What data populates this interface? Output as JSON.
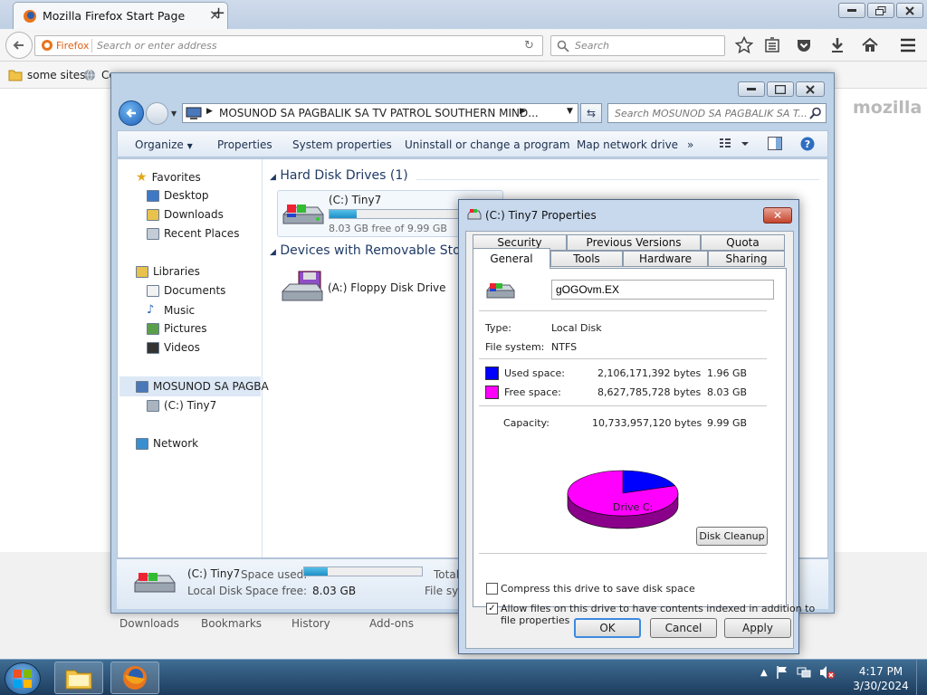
{
  "firefox": {
    "tab_title": "Mozilla Firefox Start Page",
    "new_tab": "+",
    "url_brand": "Firefox",
    "url_placeholder": "Search or enter address",
    "search_placeholder": "Search",
    "bookmarks": [
      "some sites",
      "Co"
    ],
    "brand_mark": "mozilla",
    "bottom_links": [
      "Downloads",
      "Bookmarks",
      "History",
      "Add-ons"
    ]
  },
  "explorer": {
    "address": "MOSUNOD SA PAGBALIK SA TV PATROL SOUTHERN MIND...",
    "search_placeholder": "Search MOSUNOD SA PAGBALIK SA T...",
    "toolbar": [
      "Organize",
      "Properties",
      "System properties",
      "Uninstall or change a program",
      "Map network drive",
      "»"
    ],
    "nav": {
      "favorites": "Favorites",
      "desktop": "Desktop",
      "downloads": "Downloads",
      "recent": "Recent Places",
      "libraries": "Libraries",
      "documents": "Documents",
      "music": "Music",
      "pictures": "Pictures",
      "videos": "Videos",
      "computer": "MOSUNOD SA PAGBA",
      "drive_c": "(C:) Tiny7",
      "network": "Network"
    },
    "groups": {
      "hdd": "Hard Disk Drives (1)",
      "removable": "Devices with Removable Stora"
    },
    "drive_c": {
      "name": "(C:) Tiny7",
      "free_text": "8.03 GB free of 9.99 GB",
      "used_fraction": 0.2
    },
    "drive_a": {
      "name": "(A:) Floppy Disk Drive"
    },
    "details": {
      "name": "(C:) Tiny7",
      "type": "Local Disk",
      "space_used_label": "Space used:",
      "space_free_label": "Space free:",
      "space_free": "8.03 GB",
      "total": "Total",
      "filesys": "File sys",
      "used_fraction": 0.2
    }
  },
  "dialog": {
    "title": "(C:) Tiny7 Properties",
    "tabs_back": [
      "Security",
      "Previous Versions",
      "Quota"
    ],
    "tabs_front": [
      "General",
      "Tools",
      "Hardware",
      "Sharing"
    ],
    "volume_label": "gOGOvm.EX",
    "type_label": "Type:",
    "type_value": "Local Disk",
    "fs_label": "File system:",
    "fs_value": "NTFS",
    "used_label": "Used space:",
    "used_bytes": "2,106,171,392 bytes",
    "used_gb": "1.96 GB",
    "free_label": "Free space:",
    "free_bytes": "8,627,785,728 bytes",
    "free_gb": "8.03 GB",
    "cap_label": "Capacity:",
    "cap_bytes": "10,733,957,120 bytes",
    "cap_gb": "9.99 GB",
    "drive_caption": "Drive C:",
    "cleanup": "Disk Cleanup",
    "compress": "Compress this drive to save disk space",
    "index_line1": "Allow files on this drive to have contents indexed in addition to",
    "index_line2": "file properties",
    "ok": "OK",
    "cancel": "Cancel",
    "apply": "Apply",
    "colors": {
      "used": "#0000ff",
      "free": "#ff00ff"
    }
  },
  "chart_data": {
    "type": "pie",
    "categories": [
      "Used space",
      "Free space"
    ],
    "values": [
      2106171392,
      8627785728
    ]
  },
  "taskbar": {
    "time": "4:17 PM",
    "date": "3/30/2024"
  }
}
